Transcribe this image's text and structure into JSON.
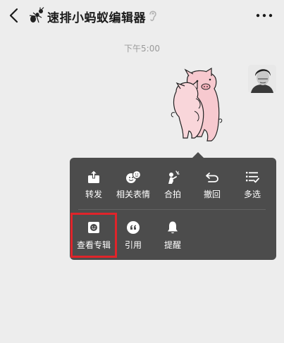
{
  "header": {
    "title": "速排小蚂蚁编辑器",
    "back_icon": "chevron-left-icon",
    "chat_icon": "ant-icon",
    "status_icon": "ear-icon",
    "more_icon": "more-dots-icon"
  },
  "chat": {
    "timestamp": "下午5:00",
    "message_type": "sticker"
  },
  "context_menu": {
    "row1": [
      {
        "label": "转发",
        "icon": "forward-icon"
      },
      {
        "label": "相关表情",
        "icon": "related-emoji-icon"
      },
      {
        "label": "合拍",
        "icon": "co-shoot-icon"
      },
      {
        "label": "撤回",
        "icon": "undo-icon"
      },
      {
        "label": "多选",
        "icon": "multi-select-icon"
      }
    ],
    "row2": [
      {
        "label": "查看专辑",
        "icon": "album-icon"
      },
      {
        "label": "引用",
        "icon": "quote-icon"
      },
      {
        "label": "提醒",
        "icon": "bell-icon"
      }
    ]
  },
  "colors": {
    "background": "#ededed",
    "menu": "#4c4c4c",
    "highlight": "#e0242a",
    "timestamp": "#9a9a9a"
  }
}
